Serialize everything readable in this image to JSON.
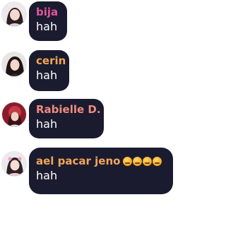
{
  "messages": [
    {
      "author": "bija",
      "text": "hah",
      "name_color": "#e0569a",
      "avatar": "avatar-bija"
    },
    {
      "author": "cerin",
      "text": "hah",
      "name_color": "#f2a65a",
      "avatar": "avatar-cerin"
    },
    {
      "author": "Rabielle D.",
      "text": "hah",
      "name_color": "#f08a80",
      "avatar": "avatar-rabielle"
    },
    {
      "author": "ael pacar jeno",
      "text": "hah",
      "name_color": "#f2a65a",
      "avatar": "avatar-ael",
      "emojis": [
        "kissing-face-icon",
        "kissing-face-icon",
        "smiling-hearts-face-icon",
        "smiling-hearts-face-icon"
      ]
    }
  ]
}
